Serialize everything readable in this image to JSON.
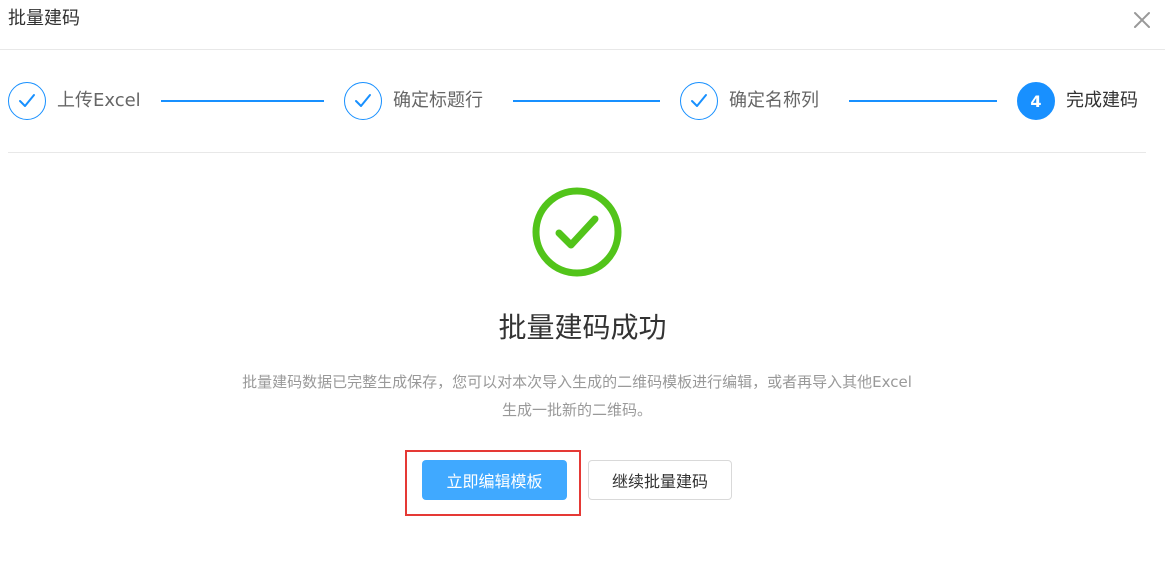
{
  "dialog": {
    "title": "批量建码",
    "close_icon": "close-icon"
  },
  "steps": [
    {
      "label": "上传Excel",
      "status": "finished",
      "icon": "check-icon"
    },
    {
      "label": "确定标题行",
      "status": "finished",
      "icon": "check-icon"
    },
    {
      "label": "确定名称列",
      "status": "finished",
      "icon": "check-icon"
    },
    {
      "label": "完成建码",
      "status": "active",
      "number": "4"
    }
  ],
  "result": {
    "icon": "success-check-icon",
    "title": "批量建码成功",
    "description_line1": "批量建码数据已完整生成保存，您可以对本次导入生成的二维码模板进行编辑，或者再导入其他Excel",
    "description_line2": "生成一批新的二维码。"
  },
  "actions": {
    "primary_label": "立即编辑模板",
    "secondary_label": "继续批量建码"
  },
  "colors": {
    "primary": "#1890ff",
    "primary_button": "#40a9ff",
    "success": "#52c41a",
    "highlight": "#e53935"
  }
}
